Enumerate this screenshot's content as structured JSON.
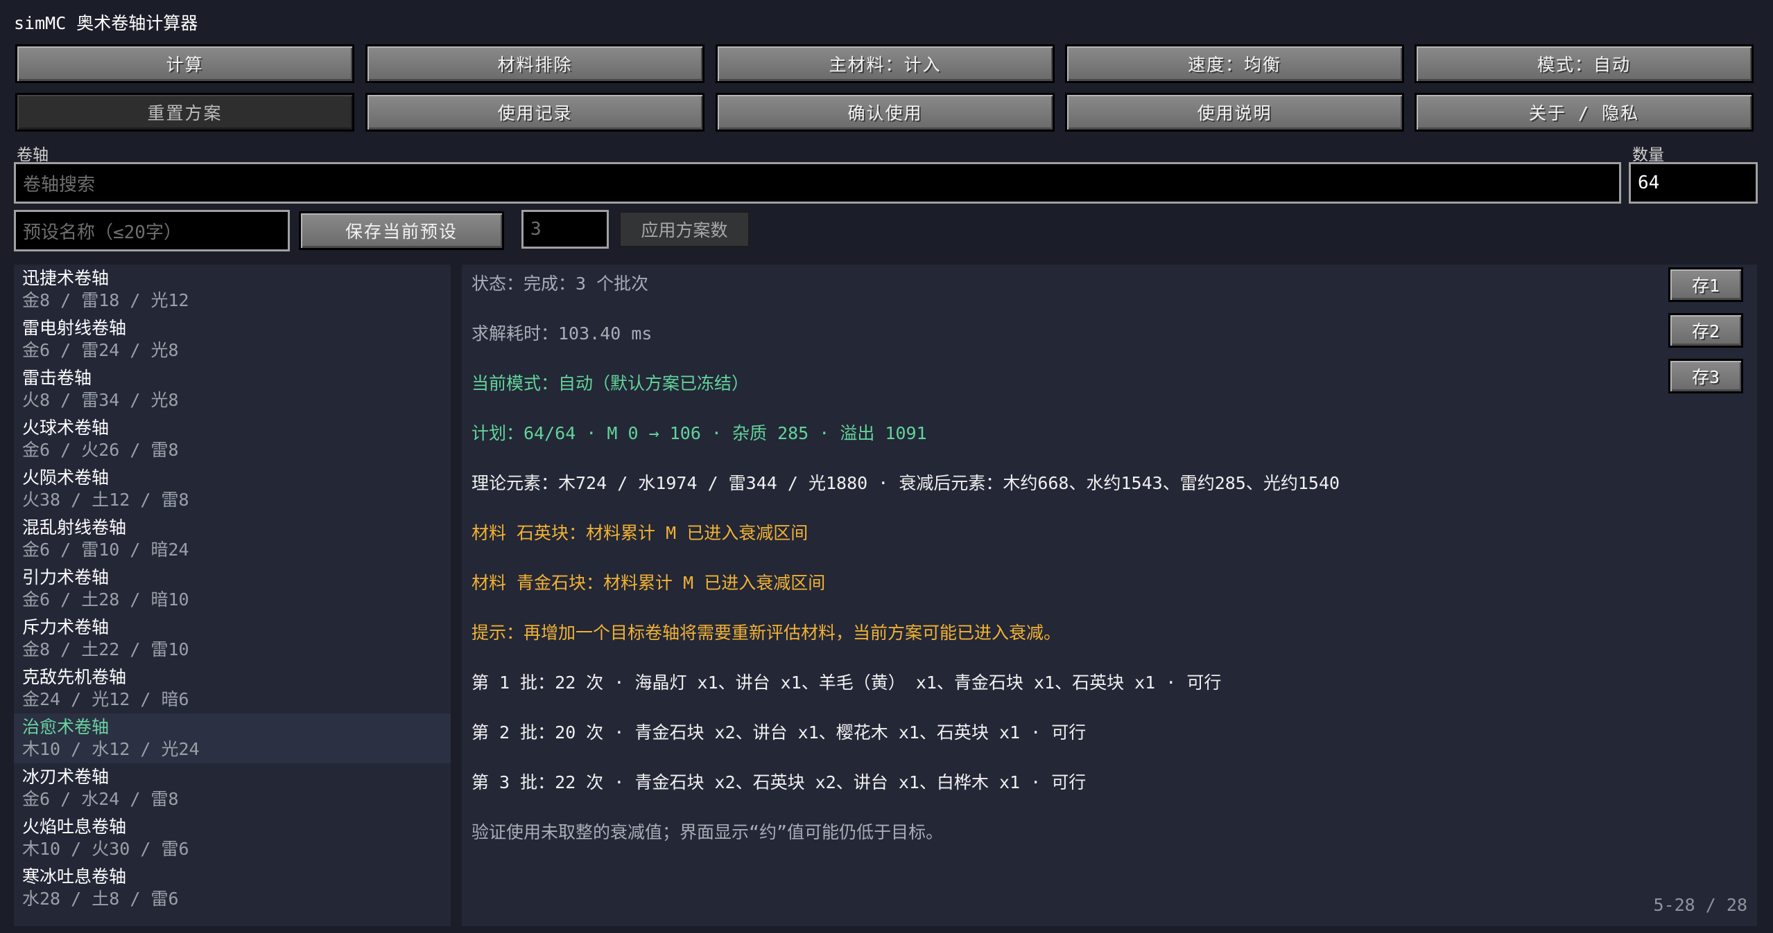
{
  "app": {
    "title": "simMC 奥术卷轴计算器"
  },
  "toolbar": {
    "row1": [
      "计算",
      "材料排除",
      "主材料：计入",
      "速度：均衡",
      "模式：自动"
    ],
    "row2": [
      "重置方案",
      "使用记录",
      "确认使用",
      "使用说明",
      "关于 / 隐私"
    ]
  },
  "search": {
    "label": "卷轴",
    "placeholder": "卷轴搜索"
  },
  "quantity": {
    "label": "数量",
    "value": "64"
  },
  "preset": {
    "name_placeholder": "预设名称（≤20字）",
    "save_label": "保存当前预设",
    "count_placeholder": "3",
    "apply_label": "应用方案数"
  },
  "scrolls": [
    {
      "name": "迅捷术卷轴",
      "elements": "金8 / 雷18 / 光12"
    },
    {
      "name": "雷电射线卷轴",
      "elements": "金6 / 雷24 / 光8"
    },
    {
      "name": "雷击卷轴",
      "elements": "火8 / 雷34 / 光8"
    },
    {
      "name": "火球术卷轴",
      "elements": "金6 / 火26 / 雷8"
    },
    {
      "name": "火陨术卷轴",
      "elements": "火38 / 土12 / 雷8"
    },
    {
      "name": "混乱射线卷轴",
      "elements": "金6 / 雷10 / 暗24"
    },
    {
      "name": "引力术卷轴",
      "elements": "金6 / 土28 / 暗10"
    },
    {
      "name": "斥力术卷轴",
      "elements": "金8 / 土22 / 雷10"
    },
    {
      "name": "克敌先机卷轴",
      "elements": "金24 / 光12 / 暗6"
    },
    {
      "name": "治愈术卷轴",
      "elements": "木10 / 水12 / 光24",
      "selected": true
    },
    {
      "name": "冰刃术卷轴",
      "elements": "金6 / 水24 / 雷8"
    },
    {
      "name": "火焰吐息卷轴",
      "elements": "木10 / 火30 / 雷6"
    },
    {
      "name": "寒冰吐息卷轴",
      "elements": "水28 / 土8 / 雷6"
    }
  ],
  "output": {
    "lines": [
      {
        "text": "状态：完成：3 个批次",
        "color": "gray"
      },
      {
        "text": "求解耗时：103.40 ms",
        "color": "gray"
      },
      {
        "text": "当前模式：自动（默认方案已冻结）",
        "color": "green"
      },
      {
        "text": "计划：64/64 · M 0 → 106 · 杂质 285 · 溢出 1091",
        "color": "green"
      },
      {
        "text": "理论元素：木724 / 水1974 / 雷344 / 光1880 · 衰减后元素：木约668、水约1543、雷约285、光约1540",
        "color": "white"
      },
      {
        "text": "材料 石英块：材料累计 M 已进入衰减区间",
        "color": "gold"
      },
      {
        "text": "材料 青金石块：材料累计 M 已进入衰减区间",
        "color": "gold"
      },
      {
        "text": "提示：再增加一个目标卷轴将需要重新评估材料，当前方案可能已进入衰减。",
        "color": "gold"
      },
      {
        "text": "第 1 批：22 次 · 海晶灯 x1、讲台 x1、羊毛（黄） x1、青金石块 x1、石英块 x1 · 可行",
        "color": "white"
      },
      {
        "text": "第 2 批：20 次 · 青金石块 x2、讲台 x1、樱花木 x1、石英块 x1 · 可行",
        "color": "white"
      },
      {
        "text": "第 3 批：22 次 · 青金石块 x2、石英块 x2、讲台 x1、白桦木 x1 · 可行",
        "color": "white"
      },
      {
        "text": "验证使用未取整的衰减值；界面显示“约”值可能仍低于目标。",
        "color": "gray"
      }
    ],
    "slots": [
      "存1",
      "存2",
      "存3"
    ],
    "page_info": "5-28 / 28"
  }
}
